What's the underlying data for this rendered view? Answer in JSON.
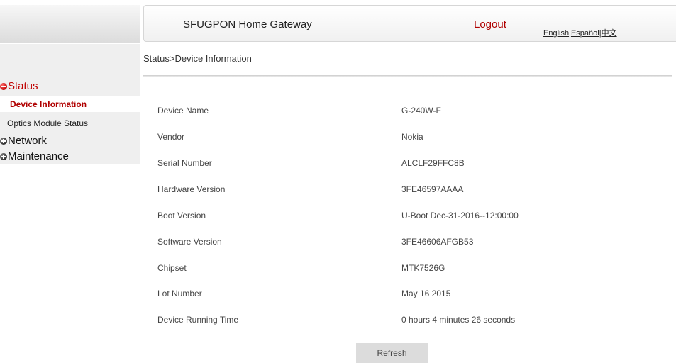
{
  "header": {
    "title": "SFUGPON Home Gateway",
    "logout": "Logout",
    "languages": [
      "English",
      "Español",
      "中文"
    ],
    "language_separator": "|"
  },
  "sidebar": {
    "groups": [
      {
        "label": "Status",
        "expanded": true,
        "icon": "minus-circle-icon",
        "items": [
          "Device Information",
          "Optics Module Status"
        ]
      },
      {
        "label": "Network",
        "expanded": false,
        "icon": "plus-circle-icon"
      },
      {
        "label": "Maintenance",
        "expanded": false,
        "icon": "plus-circle-icon"
      }
    ],
    "active_item": "Device Information"
  },
  "breadcrumb": "Status>Device Information",
  "device_info": [
    {
      "label": "Device Name",
      "value": "G-240W-F"
    },
    {
      "label": "Vendor",
      "value": "Nokia"
    },
    {
      "label": "Serial Number",
      "value": "ALCLF29FFC8B"
    },
    {
      "label": "Hardware Version",
      "value": "3FE46597AAAA"
    },
    {
      "label": "Boot Version",
      "value": "U-Boot Dec-31-2016--12:00:00"
    },
    {
      "label": "Software Version",
      "value": "3FE46606AFGB53"
    },
    {
      "label": "Chipset",
      "value": "MTK7526G"
    },
    {
      "label": "Lot Number",
      "value": "May 16 2015"
    },
    {
      "label": "Device Running Time",
      "value": "0 hours 4 minutes 26 seconds"
    }
  ],
  "refresh_label": "Refresh",
  "colors": {
    "accent": "#c00000",
    "active_item": "#b00000",
    "sidebar_bg": "#efefef",
    "button_bg": "#dcdcdc"
  }
}
